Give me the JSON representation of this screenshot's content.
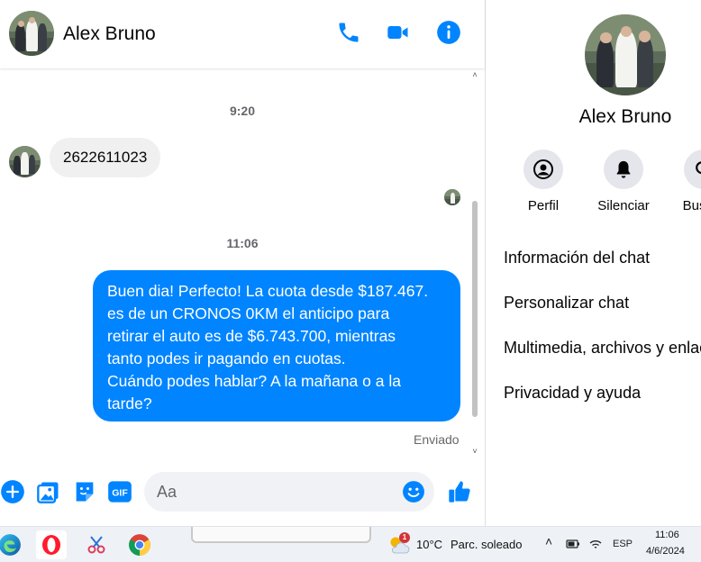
{
  "contact": {
    "name": "Alex Bruno"
  },
  "header": {
    "icons": [
      "phone-icon",
      "video-camera-icon",
      "info-icon"
    ],
    "accent_color": "#0084ff"
  },
  "messages": {
    "time_1": "9:20",
    "incoming_text": "2622611023",
    "time_2": "11:06",
    "outgoing_text": "Buen dia! Perfecto! La cuota desde $187.467.\nes de un CRONOS 0KM el anticipo para\nretirar el auto es de $6.743.700, mientras\ntanto podes ir pagando en cuotas.\nCuándo podes hablar? A la mañana o a la\ntarde?",
    "status": "Enviado",
    "outgoing_color": "#0084ff"
  },
  "composer": {
    "placeholder": "Aa",
    "icons": [
      "plus-icon",
      "image-icon",
      "sticker-icon",
      "gif-icon",
      "emoji-icon",
      "like-icon"
    ],
    "gif_label": "GIF"
  },
  "info_panel": {
    "name": "Alex Bruno",
    "actions": [
      {
        "label": "Perfil",
        "icon": "profile-icon"
      },
      {
        "label": "Silenciar",
        "icon": "bell-icon"
      },
      {
        "label": "Buscar",
        "icon": "search-icon"
      }
    ],
    "rows": [
      "Información del chat",
      "Personalizar chat",
      "Multimedia, archivos y enlaces",
      "Privacidad y ayuda"
    ]
  },
  "taskbar": {
    "apps": [
      "edge-icon",
      "opera-icon",
      "snipping-tool-icon",
      "chrome-icon"
    ],
    "weather": {
      "badge": "1",
      "temp": "10°C",
      "desc": "Parc. soleado"
    },
    "tray": {
      "language": "ESP"
    },
    "clock": {
      "time": "11:06",
      "date": "4/6/2024"
    }
  }
}
